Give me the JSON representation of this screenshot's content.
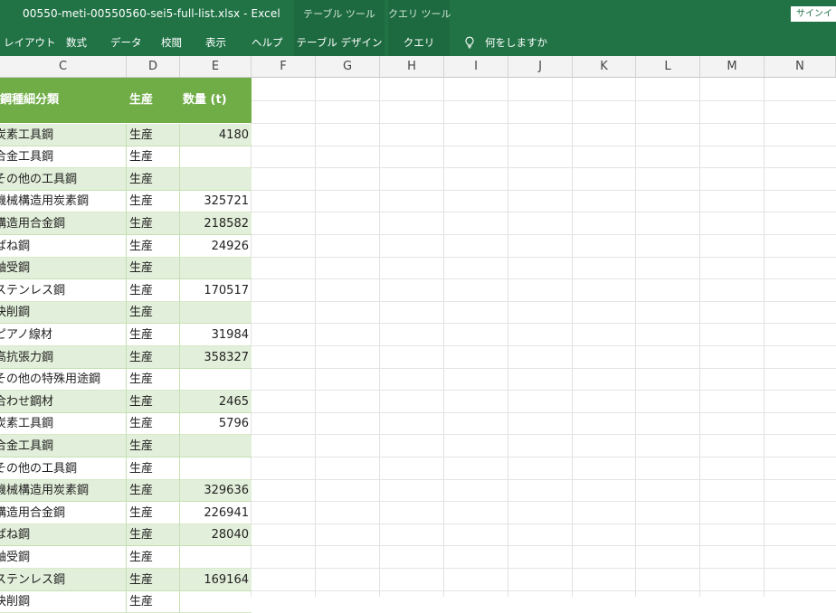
{
  "titlebar": {
    "title": "00550-meti-00550560-sei5-full-list.xlsx  -  Excel",
    "table_tools": "テーブル ツール",
    "query_tools": "クエリ ツール",
    "signin": "サインイ"
  },
  "ribbon": {
    "tabs": [
      "レイアウト",
      "数式",
      "データ",
      "校閲",
      "表示",
      "ヘルプ"
    ],
    "table_design": "テーブル デザイン",
    "query": "クエリ",
    "tell_me": "何をしますか"
  },
  "columns": [
    "C",
    "D",
    "E",
    "F",
    "G",
    "H",
    "I",
    "J",
    "K",
    "L",
    "M",
    "N"
  ],
  "table": {
    "headers": [
      "鋼種細分類",
      "生産",
      "数量 (t)"
    ],
    "rows": [
      [
        "炭素工具鋼",
        "生産",
        "4180"
      ],
      [
        "合金工具鋼",
        "生産",
        ""
      ],
      [
        "その他の工具鋼",
        "生産",
        ""
      ],
      [
        "機械構造用炭素鋼",
        "生産",
        "325721"
      ],
      [
        "構造用合金鋼",
        "生産",
        "218582"
      ],
      [
        "ばね鋼",
        "生産",
        "24926"
      ],
      [
        "軸受鋼",
        "生産",
        ""
      ],
      [
        "ステンレス鋼",
        "生産",
        "170517"
      ],
      [
        "快削鋼",
        "生産",
        ""
      ],
      [
        "ピアノ線材",
        "生産",
        "31984"
      ],
      [
        "高抗張力鋼",
        "生産",
        "358327"
      ],
      [
        "その他の特殊用途鋼",
        "生産",
        ""
      ],
      [
        "合わせ鋼材",
        "生産",
        "2465"
      ],
      [
        "炭素工具鋼",
        "生産",
        "5796"
      ],
      [
        "合金工具鋼",
        "生産",
        ""
      ],
      [
        "その他の工具鋼",
        "生産",
        ""
      ],
      [
        "機械構造用炭素鋼",
        "生産",
        "329636"
      ],
      [
        "構造用合金鋼",
        "生産",
        "226941"
      ],
      [
        "ばね鋼",
        "生産",
        "28040"
      ],
      [
        "軸受鋼",
        "生産",
        ""
      ],
      [
        "ステンレス鋼",
        "生産",
        "169164"
      ],
      [
        "快削鋼",
        "生産",
        ""
      ]
    ]
  },
  "colors": {
    "excel_green": "#217346",
    "table_header": "#70ad47",
    "band": "#e2efda"
  }
}
